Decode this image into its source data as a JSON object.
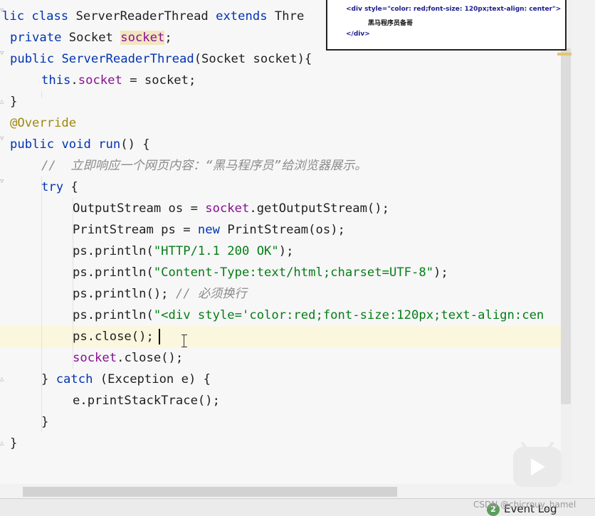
{
  "code_lines": [
    [
      {
        "t": "lic ",
        "c": "kw"
      },
      {
        "t": "class ",
        "c": "kw"
      },
      {
        "t": "ServerReaderThread ",
        "c": "type"
      },
      {
        "t": "extends ",
        "c": "kw"
      },
      {
        "t": "Thre",
        "c": "type"
      }
    ],
    [
      {
        "t": "private ",
        "c": "kw"
      },
      {
        "t": "Socket ",
        "c": "type"
      },
      {
        "t": "socket",
        "c": "field hl-word"
      },
      {
        "t": ";",
        "c": "type"
      }
    ],
    [
      {
        "t": "public ",
        "c": "kw"
      },
      {
        "t": "ServerReaderThread",
        "c": "kw"
      },
      {
        "t": "(Socket socket){",
        "c": "type"
      }
    ],
    [
      {
        "t": "this",
        "c": "kw"
      },
      {
        "t": ".",
        "c": "type"
      },
      {
        "t": "socket",
        "c": "field"
      },
      {
        "t": " = socket;",
        "c": "type"
      }
    ],
    [
      {
        "t": "}",
        "c": "type"
      }
    ],
    [
      {
        "t": "@Override",
        "c": "ann"
      }
    ],
    [
      {
        "t": "public ",
        "c": "kw"
      },
      {
        "t": "void ",
        "c": "kw"
      },
      {
        "t": "run",
        "c": "kw"
      },
      {
        "t": "() {",
        "c": "type"
      }
    ],
    [
      {
        "t": "//  立即响应一个网页内容：“黑马程序员”给浏览器展示。",
        "c": "cmt"
      }
    ],
    [
      {
        "t": "try ",
        "c": "kw"
      },
      {
        "t": "{",
        "c": "type"
      }
    ],
    [
      {
        "t": "OutputStream os = ",
        "c": "type"
      },
      {
        "t": "socket",
        "c": "field"
      },
      {
        "t": ".getOutputStream();",
        "c": "type"
      }
    ],
    [
      {
        "t": "PrintStream ps = ",
        "c": "type"
      },
      {
        "t": "new ",
        "c": "kw"
      },
      {
        "t": "PrintStream(os);",
        "c": "type"
      }
    ],
    [
      {
        "t": "ps.println(",
        "c": "type"
      },
      {
        "t": "\"HTTP/1.1 200 OK\"",
        "c": "str"
      },
      {
        "t": ");",
        "c": "type"
      }
    ],
    [
      {
        "t": "ps.println(",
        "c": "type"
      },
      {
        "t": "\"Content-Type:text/html;charset=UTF-8\"",
        "c": "str"
      },
      {
        "t": ");",
        "c": "type"
      }
    ],
    [
      {
        "t": "ps.println(); ",
        "c": "type"
      },
      {
        "t": "// 必须换行",
        "c": "cmt"
      }
    ],
    [
      {
        "t": "ps.println(",
        "c": "type"
      },
      {
        "t": "\"<div style='color:red;font-size:120px;text-align:cen",
        "c": "str"
      }
    ],
    [
      {
        "t": "ps.close();",
        "c": "type"
      }
    ],
    [
      {
        "t": "socket",
        "c": "field"
      },
      {
        "t": ".close();",
        "c": "type"
      }
    ],
    [
      {
        "t": "} ",
        "c": "type"
      },
      {
        "t": "catch ",
        "c": "kw"
      },
      {
        "t": "(Exception e) {",
        "c": "type"
      }
    ],
    [
      {
        "t": "e.printStackTrace();",
        "c": "type"
      }
    ],
    [
      {
        "t": "}",
        "c": "type"
      }
    ],
    [
      {
        "t": "}",
        "c": "type"
      }
    ]
  ],
  "popup": {
    "line1_tag": "<div style=\"",
    "line1_style": "color: red;font-size: 120px;text-align: center",
    "line1_end": "\">",
    "line2": "黑马程序员备哥",
    "line3": "</div>"
  },
  "status": {
    "event_count": "2",
    "event_label": "Event Log"
  },
  "watermark": "CSDN @chicrouy_hamel"
}
